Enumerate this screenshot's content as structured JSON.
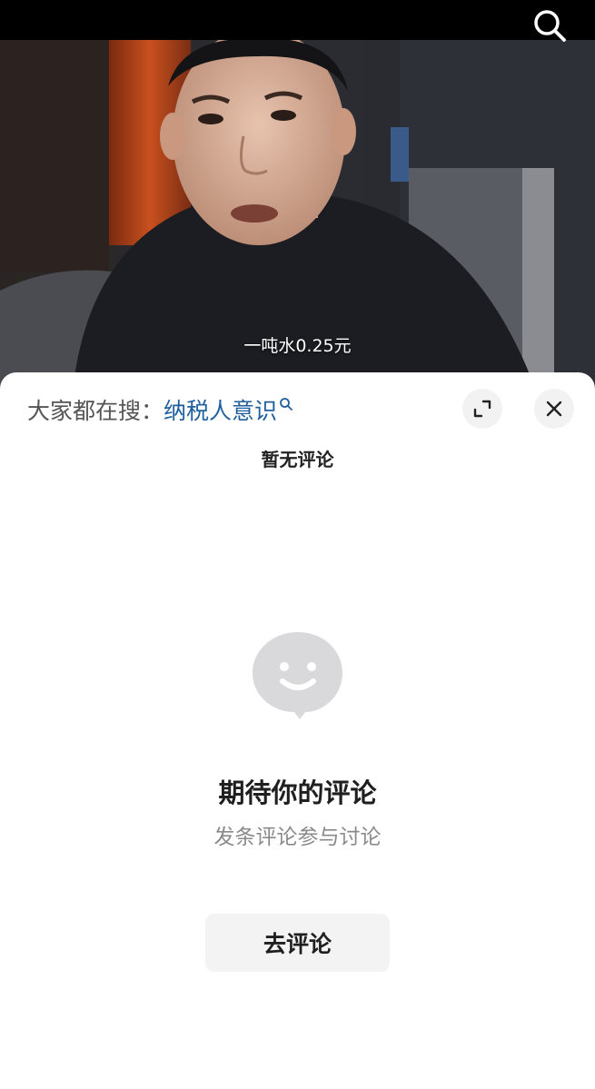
{
  "video": {
    "subtitle": "一吨水0.25元"
  },
  "topbar": {
    "search_icon": "search-icon"
  },
  "sheet": {
    "search_hint_prefix": "大家都在搜：",
    "search_hint_keyword": "纳税人意识",
    "search_hint_icon": "search-icon",
    "expand_icon": "expand-icon",
    "close_icon": "close-icon",
    "no_comments_label": "暂无评论",
    "empty_state": {
      "icon": "smiley-speech-bubble-icon",
      "title": "期待你的评论",
      "subtitle": "发条评论参与讨论",
      "button_label": "去评论"
    }
  },
  "colors": {
    "keyword": "#1f5f9e",
    "sheet_bg": "#ffffff",
    "button_bg": "#f3f3f3",
    "illustration": "#d9d9dc"
  }
}
